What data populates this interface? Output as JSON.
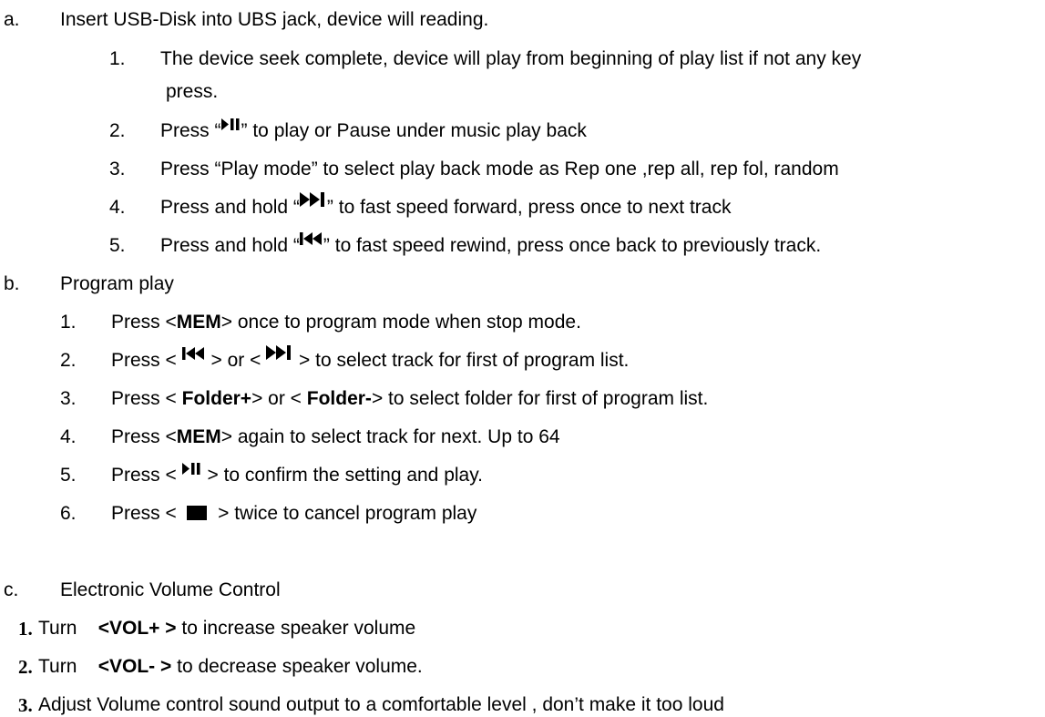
{
  "sections": {
    "a": {
      "marker": "a.",
      "title": "Insert USB-Disk into UBS jack, device will reading.",
      "items": [
        {
          "num": "1.",
          "line1": "The device seek complete, device will play from beginning of play list if not any key",
          "line2": "press."
        },
        {
          "num": "2.",
          "pre": "Press “",
          "post": "” to play or Pause under music play back",
          "icon": "play-pause-icon"
        },
        {
          "num": "3.",
          "text": "Press “Play mode” to select play back mode as Rep one ,rep all, rep fol, random"
        },
        {
          "num": "4.",
          "pre": "Press and hold “",
          "post": "” to fast speed forward, press once to next track",
          "icon": "next-track-icon"
        },
        {
          "num": "5.",
          "pre": "Press and hold “",
          "post": "” to fast speed rewind, press once back to previously track.",
          "icon": "previous-track-icon"
        }
      ]
    },
    "b": {
      "marker": "b.",
      "title": "Program play",
      "items": [
        {
          "num": "1.",
          "pre": "Press <",
          "bold": "MEM",
          "post": "> once to program mode when stop mode."
        },
        {
          "num": "2.",
          "pre": "Press <",
          "mid": "> or <",
          "post": "> to select track for first of program list."
        },
        {
          "num": "3.",
          "pre": "Press < ",
          "bold": "Folder+",
          "mid": "> or < ",
          "bold2": "Folder-",
          "post": "> to select folder for first of program list."
        },
        {
          "num": "4.",
          "pre": "Press <",
          "bold": "MEM",
          "post": "> again to select track for next. Up to 64"
        },
        {
          "num": "5.",
          "pre": "Press <",
          "post": "> to confirm the setting and play."
        },
        {
          "num": "6.",
          "pre": "Press <",
          "post": "> twice to cancel program play"
        }
      ]
    },
    "c": {
      "marker": "c.",
      "title": "Electronic Volume Control",
      "items": [
        {
          "num": "1.",
          "pre": "Turn",
          "bold": "<VOL+ >",
          "post": " to increase speaker volume"
        },
        {
          "num": "2.",
          "pre": "Turn",
          "bold": "<VOL- >",
          "post": " to decrease speaker volume."
        },
        {
          "num": "3.",
          "text": "Adjust Volume control sound output to a comfortable level , don’t make it too loud"
        }
      ]
    }
  }
}
